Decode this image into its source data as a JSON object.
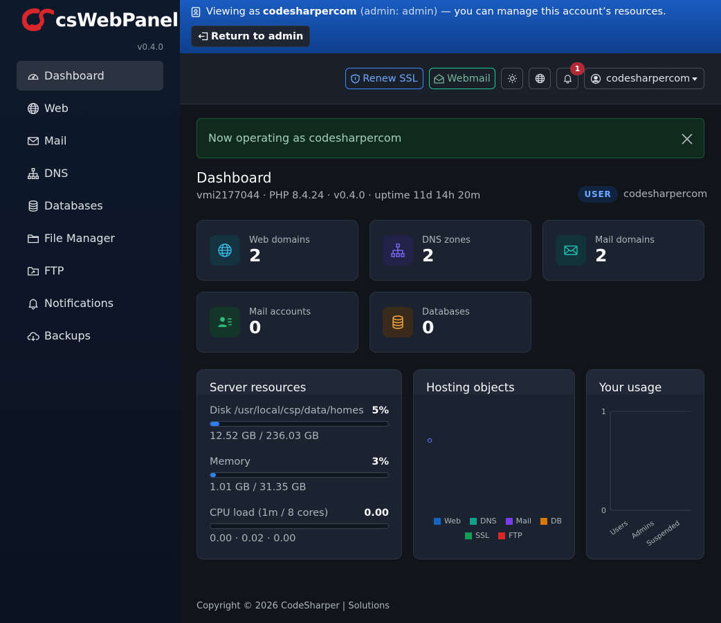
{
  "brand": {
    "name": "csWebPanel",
    "version": "v0.4.0"
  },
  "sidebar": {
    "items": [
      {
        "label": "Dashboard",
        "icon": "gauge-icon",
        "active": true
      },
      {
        "label": "Web",
        "icon": "globe-icon"
      },
      {
        "label": "Mail",
        "icon": "envelope-icon"
      },
      {
        "label": "DNS",
        "icon": "sitemap-icon"
      },
      {
        "label": "Databases",
        "icon": "database-icon"
      },
      {
        "label": "File Manager",
        "icon": "folder-icon"
      },
      {
        "label": "FTP",
        "icon": "folder-upload-icon"
      },
      {
        "label": "Notifications",
        "icon": "bell-icon"
      },
      {
        "label": "Backups",
        "icon": "cloud-download-icon"
      }
    ]
  },
  "banner": {
    "prefix": "Viewing as",
    "account": "codesharpercom",
    "admin_note": "(admin: admin)",
    "suffix": "— you can manage this account’s resources.",
    "return_label": "Return to admin"
  },
  "header": {
    "renew_ssl_label": "Renew SSL",
    "webmail_label": "Webmail",
    "notification_count": "1",
    "user_label": "codesharpercom"
  },
  "alert": {
    "message": "Now operating as codesharpercom"
  },
  "page": {
    "title": "Dashboard",
    "subtitle": "vmi2177044 · PHP 8.4.24 · v0.4.0 · uptime 11d 14h 20m",
    "role_badge": "USER",
    "role_user": "codesharpercom"
  },
  "stats": {
    "web": {
      "label": "Web domains",
      "value": "2"
    },
    "dns": {
      "label": "DNS zones",
      "value": "2"
    },
    "mail": {
      "label": "Mail domains",
      "value": "2"
    },
    "accounts": {
      "label": "Mail accounts",
      "value": "0"
    },
    "db": {
      "label": "Databases",
      "value": "0"
    }
  },
  "server": {
    "title": "Server resources",
    "disk": {
      "label": "Disk /usr/local/csp/data/homes",
      "pct": "5%",
      "fill": 5,
      "detail": "12.52 GB / 236.03 GB"
    },
    "memory": {
      "label": "Memory",
      "pct": "3%",
      "fill": 3,
      "detail": "1.01 GB / 31.35 GB"
    },
    "cpu": {
      "label": "CPU load (1m / 8 cores)",
      "pct": "0.00",
      "fill": 0,
      "detail": "0.00 · 0.02 · 0.00"
    }
  },
  "hosting": {
    "title": "Hosting objects",
    "legend": [
      {
        "label": "Web",
        "color": "#1565c0"
      },
      {
        "label": "DNS",
        "color": "#12a08a"
      },
      {
        "label": "Mail",
        "color": "#7c3aed"
      },
      {
        "label": "DB",
        "color": "#d97706"
      },
      {
        "label": "SSL",
        "color": "#0f9d58"
      },
      {
        "label": "FTP",
        "color": "#dc2626"
      }
    ]
  },
  "usage": {
    "title": "Your usage",
    "y_ticks": [
      "1",
      "0"
    ],
    "x_labels": [
      "Users",
      "Admins",
      "Suspended"
    ]
  },
  "footer": {
    "text": "Copyright © 2026 CodeSharper | Solutions"
  }
}
